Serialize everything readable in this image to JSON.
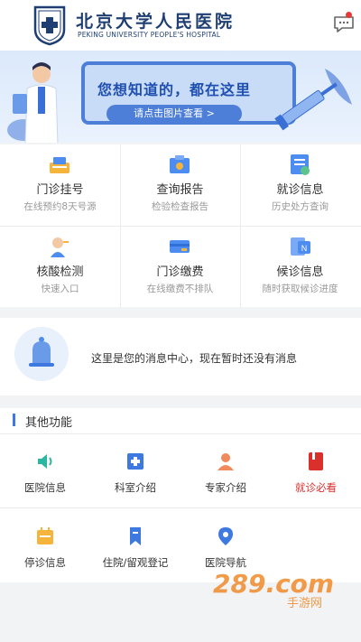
{
  "header": {
    "title_cn": "北京大学人民医院",
    "title_en": "PEKING UNIVERSITY PEOPLE'S HOSPITAL"
  },
  "banner": {
    "headline": "您想知道的，都在这里",
    "cta": "请点击图片查看 >"
  },
  "services": [
    {
      "title": "门诊挂号",
      "subtitle": "在线预约8天号源",
      "icon": "registration-icon"
    },
    {
      "title": "查询报告",
      "subtitle": "检验检查报告",
      "icon": "report-icon"
    },
    {
      "title": "就诊信息",
      "subtitle": "历史处方查询",
      "icon": "visit-info-icon"
    },
    {
      "title": "核酸检测",
      "subtitle": "快速入口",
      "icon": "nucleic-test-icon"
    },
    {
      "title": "门诊缴费",
      "subtitle": "在线缴费不排队",
      "icon": "payment-icon"
    },
    {
      "title": "候诊信息",
      "subtitle": "随时获取候诊进度",
      "icon": "waiting-info-icon"
    }
  ],
  "message_center": {
    "text": "这里是您的消息中心，现在暂时还没有消息"
  },
  "other_functions": {
    "title": "其他功能",
    "items": [
      {
        "label": "医院信息",
        "icon": "speaker-icon"
      },
      {
        "label": "科室介绍",
        "icon": "department-icon"
      },
      {
        "label": "专家介绍",
        "icon": "expert-icon"
      },
      {
        "label": "就诊必看",
        "icon": "book-icon"
      },
      {
        "label": "停诊信息",
        "icon": "calendar-icon"
      },
      {
        "label": "住院/留观登记",
        "icon": "bookmark-icon"
      },
      {
        "label": "医院导航",
        "icon": "location-pin-icon"
      }
    ]
  },
  "watermark": {
    "main": "289.com",
    "sub": "手游网"
  },
  "colors": {
    "accent_blue": "#3d79e0",
    "highlight_red": "#d9302c",
    "brand_navy": "#1f3f73"
  }
}
